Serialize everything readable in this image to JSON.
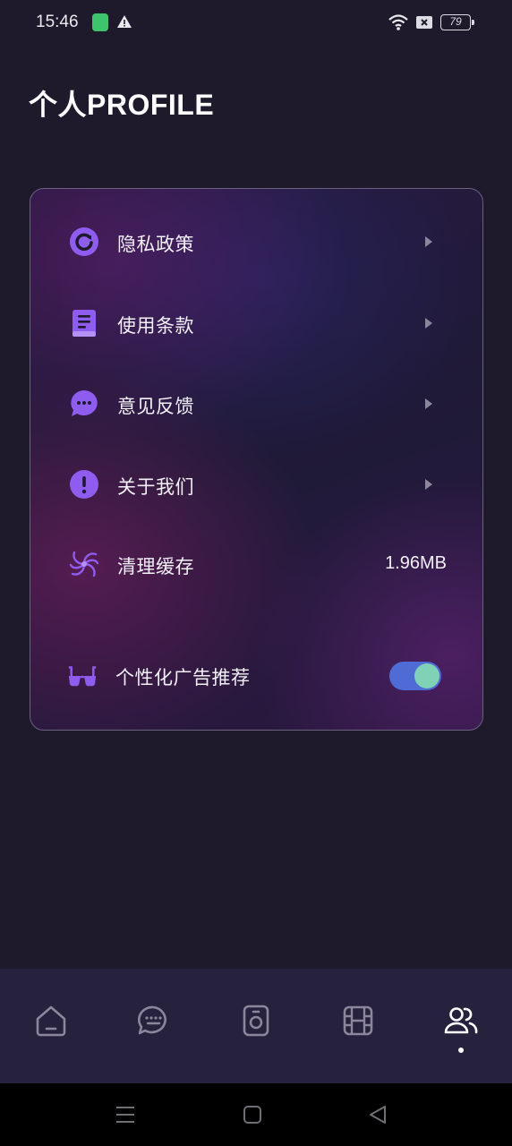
{
  "status_bar": {
    "time": "15:46",
    "battery": "79",
    "icons": [
      "app-notification-icon",
      "warning-icon",
      "wifi-icon",
      "sim-x-icon",
      "battery-icon"
    ]
  },
  "page": {
    "title": "个人PROFILE"
  },
  "menu": {
    "items": [
      {
        "label": "隐私政策",
        "icon": "refresh-circle-icon"
      },
      {
        "label": "使用条款",
        "icon": "book-icon"
      },
      {
        "label": "意见反馈",
        "icon": "chat-bubble-icon"
      },
      {
        "label": "关于我们",
        "icon": "info-alert-icon"
      },
      {
        "label": "清理缓存",
        "icon": "vortex-icon",
        "value": "1.96MB"
      },
      {
        "label": "个性化广告推荐",
        "icon": "glasses-icon",
        "toggle_on": true
      }
    ]
  },
  "bottom_nav": {
    "items": [
      "home-icon",
      "message-icon",
      "camera-icon",
      "film-icon",
      "profile-icon"
    ],
    "active": "profile-icon"
  },
  "colors": {
    "background": "#1e1a2c",
    "card_border": "#6b6280",
    "icon_purple": "#8f5cf0",
    "toggle_track": "#4f6bd6",
    "toggle_knob": "#7fd2b6",
    "nav_background": "#26213d"
  }
}
